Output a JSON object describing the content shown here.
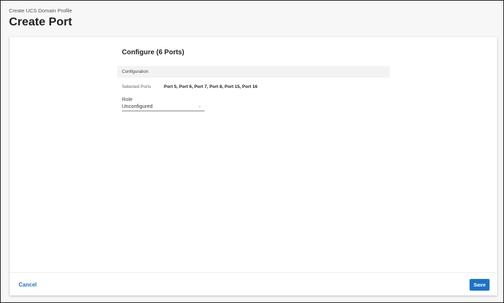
{
  "header": {
    "breadcrumb": "Create UCS Domain Profile",
    "title": "Create Port"
  },
  "form": {
    "heading": "Configure (6 Ports)",
    "section_title": "Configuration",
    "selected_ports_label": "Selected Ports",
    "selected_ports_value": "Port 5, Port 6, Port 7, Port 8, Port 15, Port 16",
    "role_label": "Role",
    "role_value": "Unconfigured"
  },
  "footer": {
    "cancel_label": "Cancel",
    "save_label": "Save",
    "accent": "#1a73c8"
  }
}
